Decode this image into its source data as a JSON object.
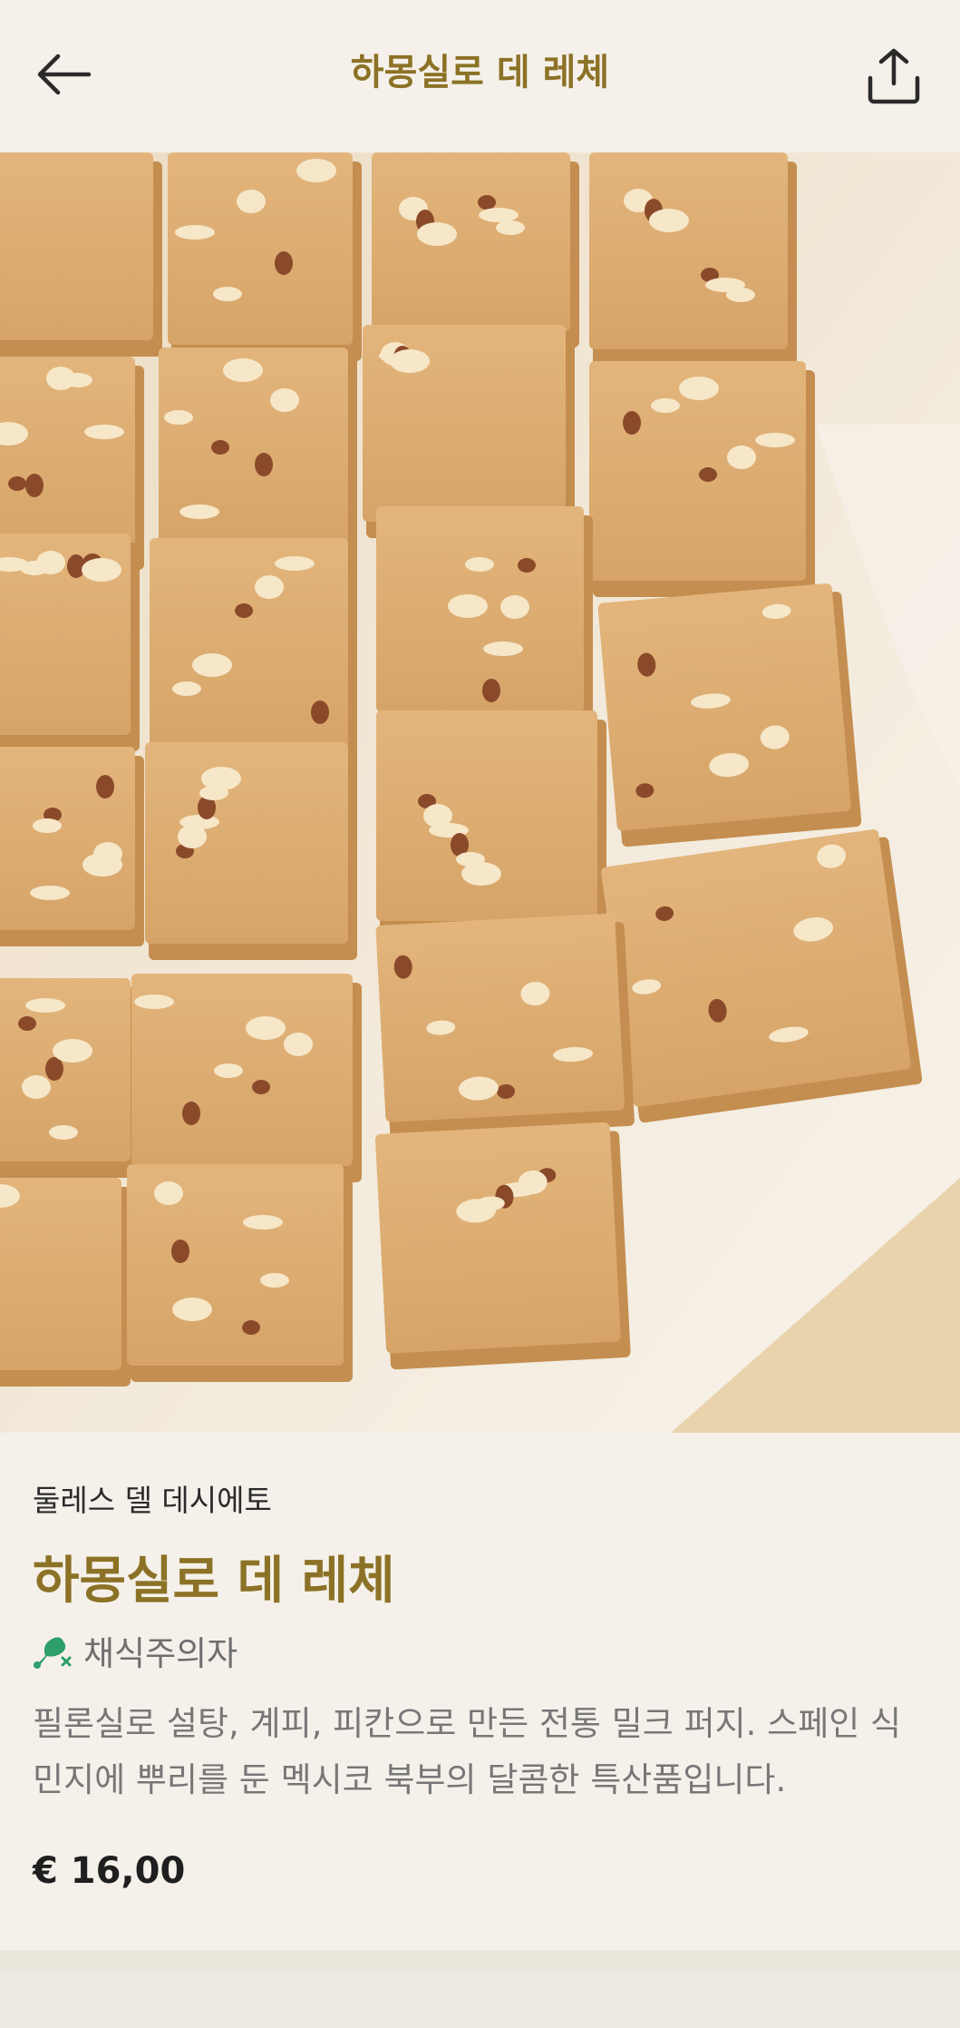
{
  "header": {
    "title": "하몽실로 데 레체",
    "back_icon": "arrow-left-icon",
    "share_icon": "share-icon"
  },
  "hero_image": {
    "subject": "fudge-squares-with-pecans-on-parchment"
  },
  "product": {
    "vendor": "둘레스 델 데시에토",
    "title": "하몽실로 데 레체",
    "diet_tag": {
      "icon": "drumstick-crossed-icon",
      "label": "채식주의자"
    },
    "description": "필론실로 설탕, 계피, 피칸으로 만든 전통 밀크 퍼지. 스페인 식민지에 뿌리를 둔 멕시코 북부의 달콤한 특산품입니다.",
    "price": "€ 16,00"
  },
  "colors": {
    "accent": "#8c7226",
    "background": "#f5f1ea",
    "diet_icon": "#2e9e6a"
  }
}
